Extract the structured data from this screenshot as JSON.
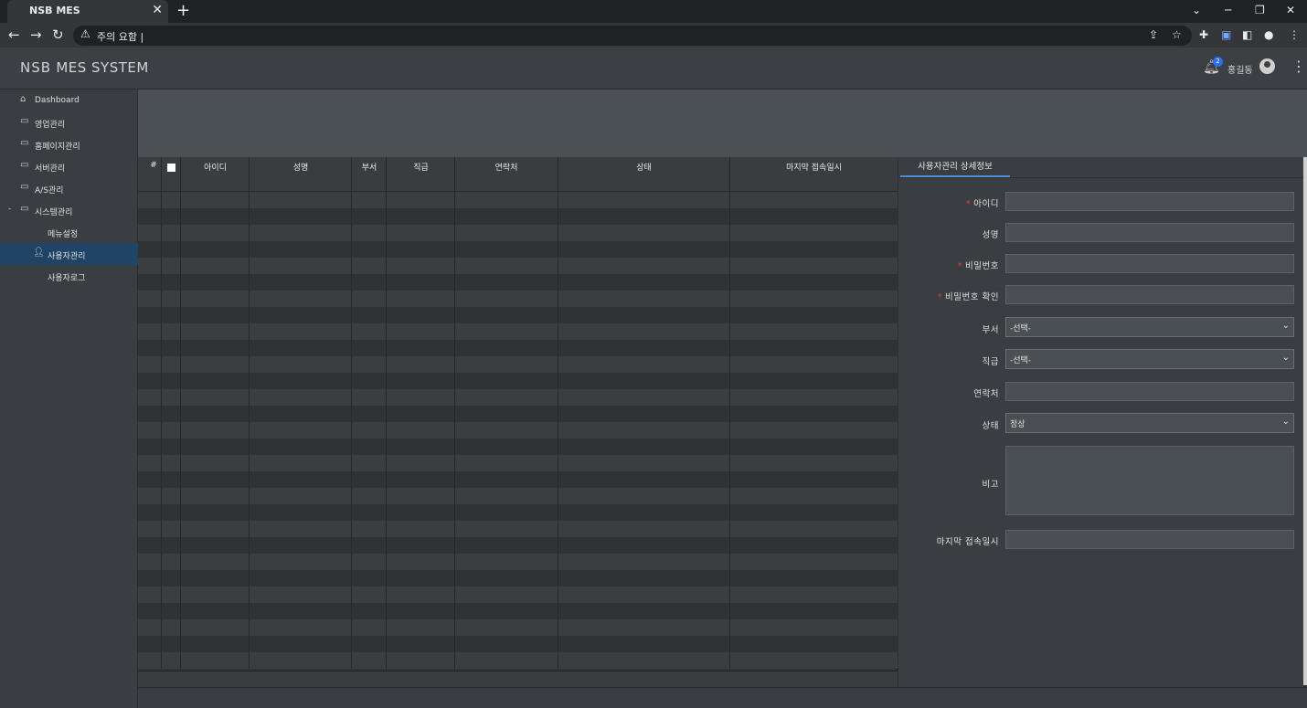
{
  "browser": {
    "tab_title": "NSB MES",
    "tab_close": "✕",
    "new_tab": "+",
    "address_warning": "주의 요함",
    "address_url": "|"
  },
  "header": {
    "logo_nsb": "NSB",
    "logo_system": "MES SYSTEM",
    "notification_count": "2",
    "user_name": "홍길동"
  },
  "sidebar": {
    "items": [
      {
        "label": "Dashboard",
        "icon": "home-icon"
      },
      {
        "label": "영업관리",
        "icon": "folder-icon"
      },
      {
        "label": "홈페이지관리",
        "icon": "folder-icon"
      },
      {
        "label": "서버관리",
        "icon": "folder-icon"
      },
      {
        "label": "A/S관리",
        "icon": "folder-icon"
      },
      {
        "label": "시스템관리",
        "icon": "folder-icon",
        "expand": "-"
      },
      {
        "label": "메뉴설정"
      },
      {
        "label": "사용자관리",
        "icon": "user-icon",
        "active": true
      },
      {
        "label": "사용자로그"
      }
    ]
  },
  "grid": {
    "columns": [
      "#",
      "",
      "아이디",
      "성명",
      "부서",
      "직급",
      "연락처",
      "상태",
      "마지막 접속일시"
    ],
    "rows": []
  },
  "detail": {
    "tab_label": "사용자관리 상세정보",
    "fields": {
      "id_label": "아이디",
      "name_label": "성명",
      "password_label": "비밀번호",
      "password_confirm_label": "비밀번호 확인",
      "department_label": "부서",
      "department_value": "-선택-",
      "position_label": "직급",
      "position_value": "-선택-",
      "contact_label": "연락처",
      "status_label": "상태",
      "status_value": "정상",
      "memo_label": "비고",
      "last_login_label": "마지막 접속일시"
    },
    "required_marker": "*"
  },
  "colors": {
    "accent": "#4a8fd8",
    "active_nav": "#1f4466",
    "required": "#e03c3c"
  }
}
